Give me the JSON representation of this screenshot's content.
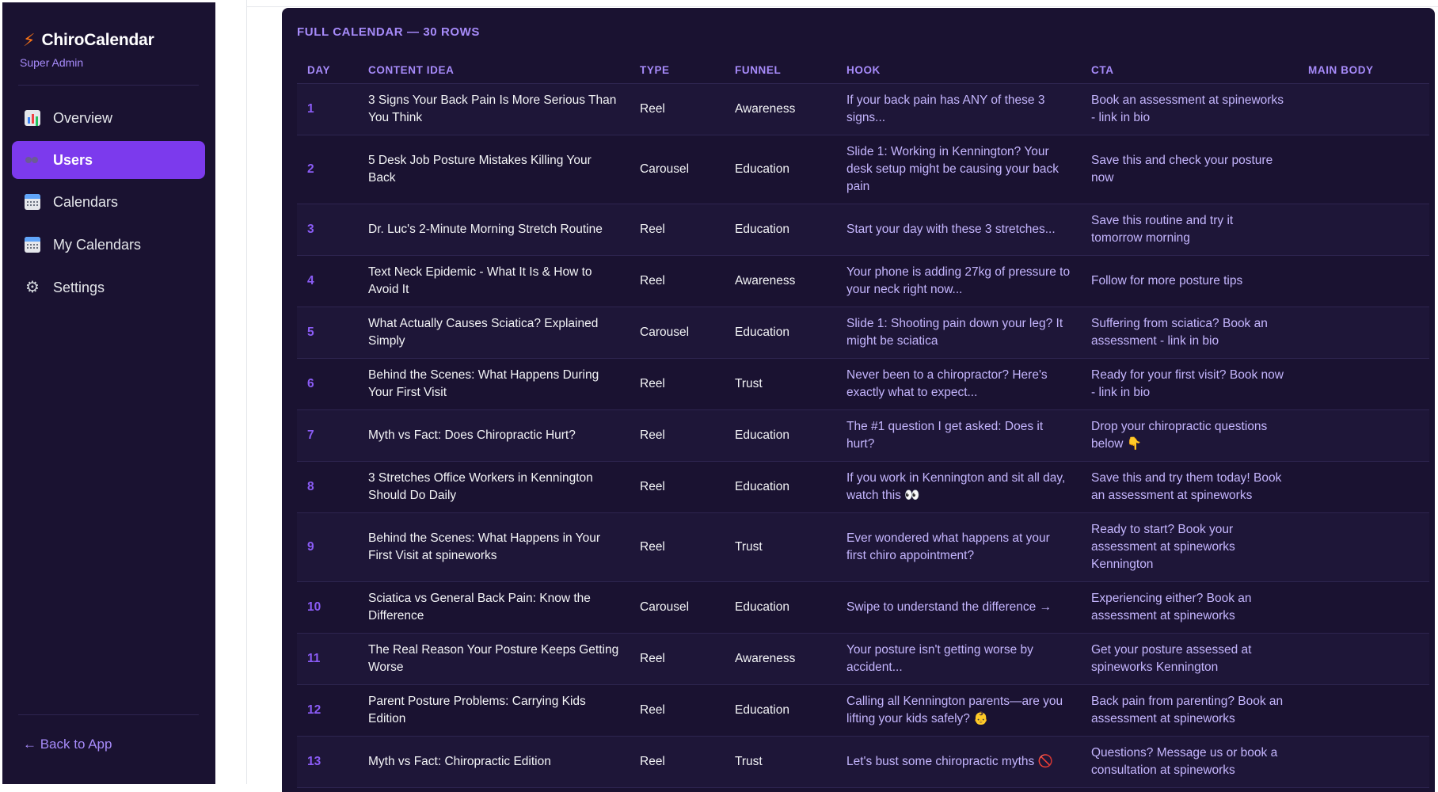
{
  "sidebar": {
    "brand": "ChiroCalendar",
    "role": "Super Admin",
    "items": [
      {
        "label": "Overview"
      },
      {
        "label": "Users"
      },
      {
        "label": "Calendars"
      },
      {
        "label": "My Calendars"
      },
      {
        "label": "Settings"
      }
    ],
    "back": "← Back to App"
  },
  "panel": {
    "title": "FULL CALENDAR — 30 ROWS",
    "columns": [
      "DAY",
      "CONTENT IDEA",
      "TYPE",
      "FUNNEL",
      "HOOK",
      "CTA",
      "MAIN BODY"
    ],
    "rows": [
      {
        "day": "1",
        "idea": "3 Signs Your Back Pain Is More Serious Than You Think",
        "type": "Reel",
        "funnel": "Awareness",
        "hook": "If your back pain has ANY of these 3 signs...",
        "cta": "Book an assessment at spineworks - link in bio",
        "body": ""
      },
      {
        "day": "2",
        "idea": "5 Desk Job Posture Mistakes Killing Your Back",
        "type": "Carousel",
        "funnel": "Education",
        "hook": "Slide 1: Working in Kennington? Your desk setup might be causing your back pain",
        "cta": "Save this and check your posture now",
        "body": ""
      },
      {
        "day": "3",
        "idea": "Dr. Luc's 2-Minute Morning Stretch Routine",
        "type": "Reel",
        "funnel": "Education",
        "hook": "Start your day with these 3 stretches...",
        "cta": "Save this routine and try it tomorrow morning",
        "body": ""
      },
      {
        "day": "4",
        "idea": "Text Neck Epidemic - What It Is & How to Avoid It",
        "type": "Reel",
        "funnel": "Awareness",
        "hook": "Your phone is adding 27kg of pressure to your neck right now...",
        "cta": "Follow for more posture tips",
        "body": ""
      },
      {
        "day": "5",
        "idea": "What Actually Causes Sciatica? Explained Simply",
        "type": "Carousel",
        "funnel": "Education",
        "hook": "Slide 1: Shooting pain down your leg? It might be sciatica",
        "cta": "Suffering from sciatica? Book an assessment - link in bio",
        "body": ""
      },
      {
        "day": "6",
        "idea": "Behind the Scenes: What Happens During Your First Visit",
        "type": "Reel",
        "funnel": "Trust",
        "hook": "Never been to a chiropractor? Here's exactly what to expect...",
        "cta": "Ready for your first visit? Book now - link in bio",
        "body": ""
      },
      {
        "day": "7",
        "idea": "Myth vs Fact: Does Chiropractic Hurt?",
        "type": "Reel",
        "funnel": "Education",
        "hook": "The #1 question I get asked: Does it hurt?",
        "cta": "Drop your chiropractic questions below 👇",
        "body": ""
      },
      {
        "day": "8",
        "idea": "3 Stretches Office Workers in Kennington Should Do Daily",
        "type": "Reel",
        "funnel": "Education",
        "hook": "If you work in Kennington and sit all day, watch this 👀",
        "cta": "Save this and try them today! Book an assessment at spineworks",
        "body": ""
      },
      {
        "day": "9",
        "idea": "Behind the Scenes: What Happens in Your First Visit at spineworks",
        "type": "Reel",
        "funnel": "Trust",
        "hook": "Ever wondered what happens at your first chiro appointment?",
        "cta": "Ready to start? Book your assessment at spineworks Kennington",
        "body": ""
      },
      {
        "day": "10",
        "idea": "Sciatica vs General Back Pain: Know the Difference",
        "type": "Carousel",
        "funnel": "Education",
        "hook": "Swipe to understand the difference →",
        "cta": "Experiencing either? Book an assessment at spineworks",
        "body": ""
      },
      {
        "day": "11",
        "idea": "The Real Reason Your Posture Keeps Getting Worse",
        "type": "Reel",
        "funnel": "Awareness",
        "hook": "Your posture isn't getting worse by accident...",
        "cta": "Get your posture assessed at spineworks Kennington",
        "body": ""
      },
      {
        "day": "12",
        "idea": "Parent Posture Problems: Carrying Kids Edition",
        "type": "Reel",
        "funnel": "Education",
        "hook": "Calling all Kennington parents—are you lifting your kids safely? 👶",
        "cta": "Back pain from parenting? Book an assessment at spineworks",
        "body": ""
      },
      {
        "day": "13",
        "idea": "Myth vs Fact: Chiropractic Edition",
        "type": "Reel",
        "funnel": "Trust",
        "hook": "Let's bust some chiropractic myths 🚫",
        "cta": "Questions? Message us or book a consultation at spineworks",
        "body": ""
      }
    ]
  },
  "colors": {
    "sidebar_bg": "#1a1231",
    "accent": "#7c3aed",
    "accent_text": "#a78bfa",
    "brand_bolt": "#f97316"
  }
}
